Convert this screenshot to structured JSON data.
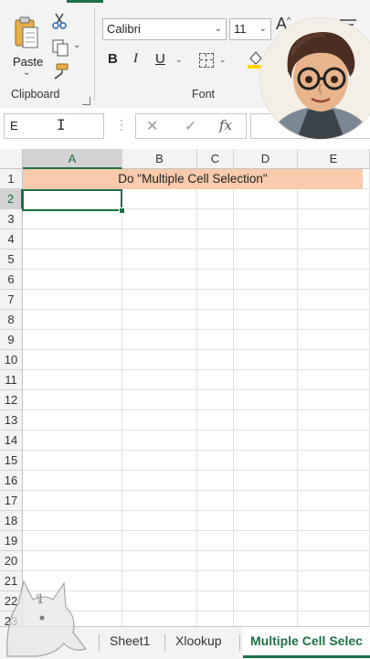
{
  "ribbon": {
    "clipboard": {
      "paste_label": "Paste",
      "group_label": "Clipboard"
    },
    "font": {
      "font_name": "Calibri",
      "font_size": "11",
      "bold": "B",
      "italic": "I",
      "underline": "U",
      "group_label": "Font"
    }
  },
  "formula_bar": {
    "name_box_value": "E",
    "cancel_symbol": "✕",
    "enter_symbol": "✓",
    "fx_label": "fx"
  },
  "grid": {
    "columns": [
      "A",
      "B",
      "C",
      "D",
      "E"
    ],
    "rows": [
      "1",
      "2",
      "3",
      "4",
      "5",
      "6",
      "7",
      "8",
      "9",
      "10",
      "11",
      "12",
      "13",
      "14",
      "15",
      "16",
      "17",
      "18",
      "19",
      "20",
      "21",
      "22",
      "23"
    ],
    "active_column": "A",
    "active_row": "2",
    "merged_text": "Do \"Multiple Cell Selection\"",
    "merged_fill": "#f8cbad"
  },
  "sheets": {
    "tabs": [
      "Sheet1",
      "Xlookup",
      "Multiple Cell Selec"
    ],
    "active": "Multiple Cell Selec"
  },
  "colors": {
    "accent": "#1e7145"
  }
}
